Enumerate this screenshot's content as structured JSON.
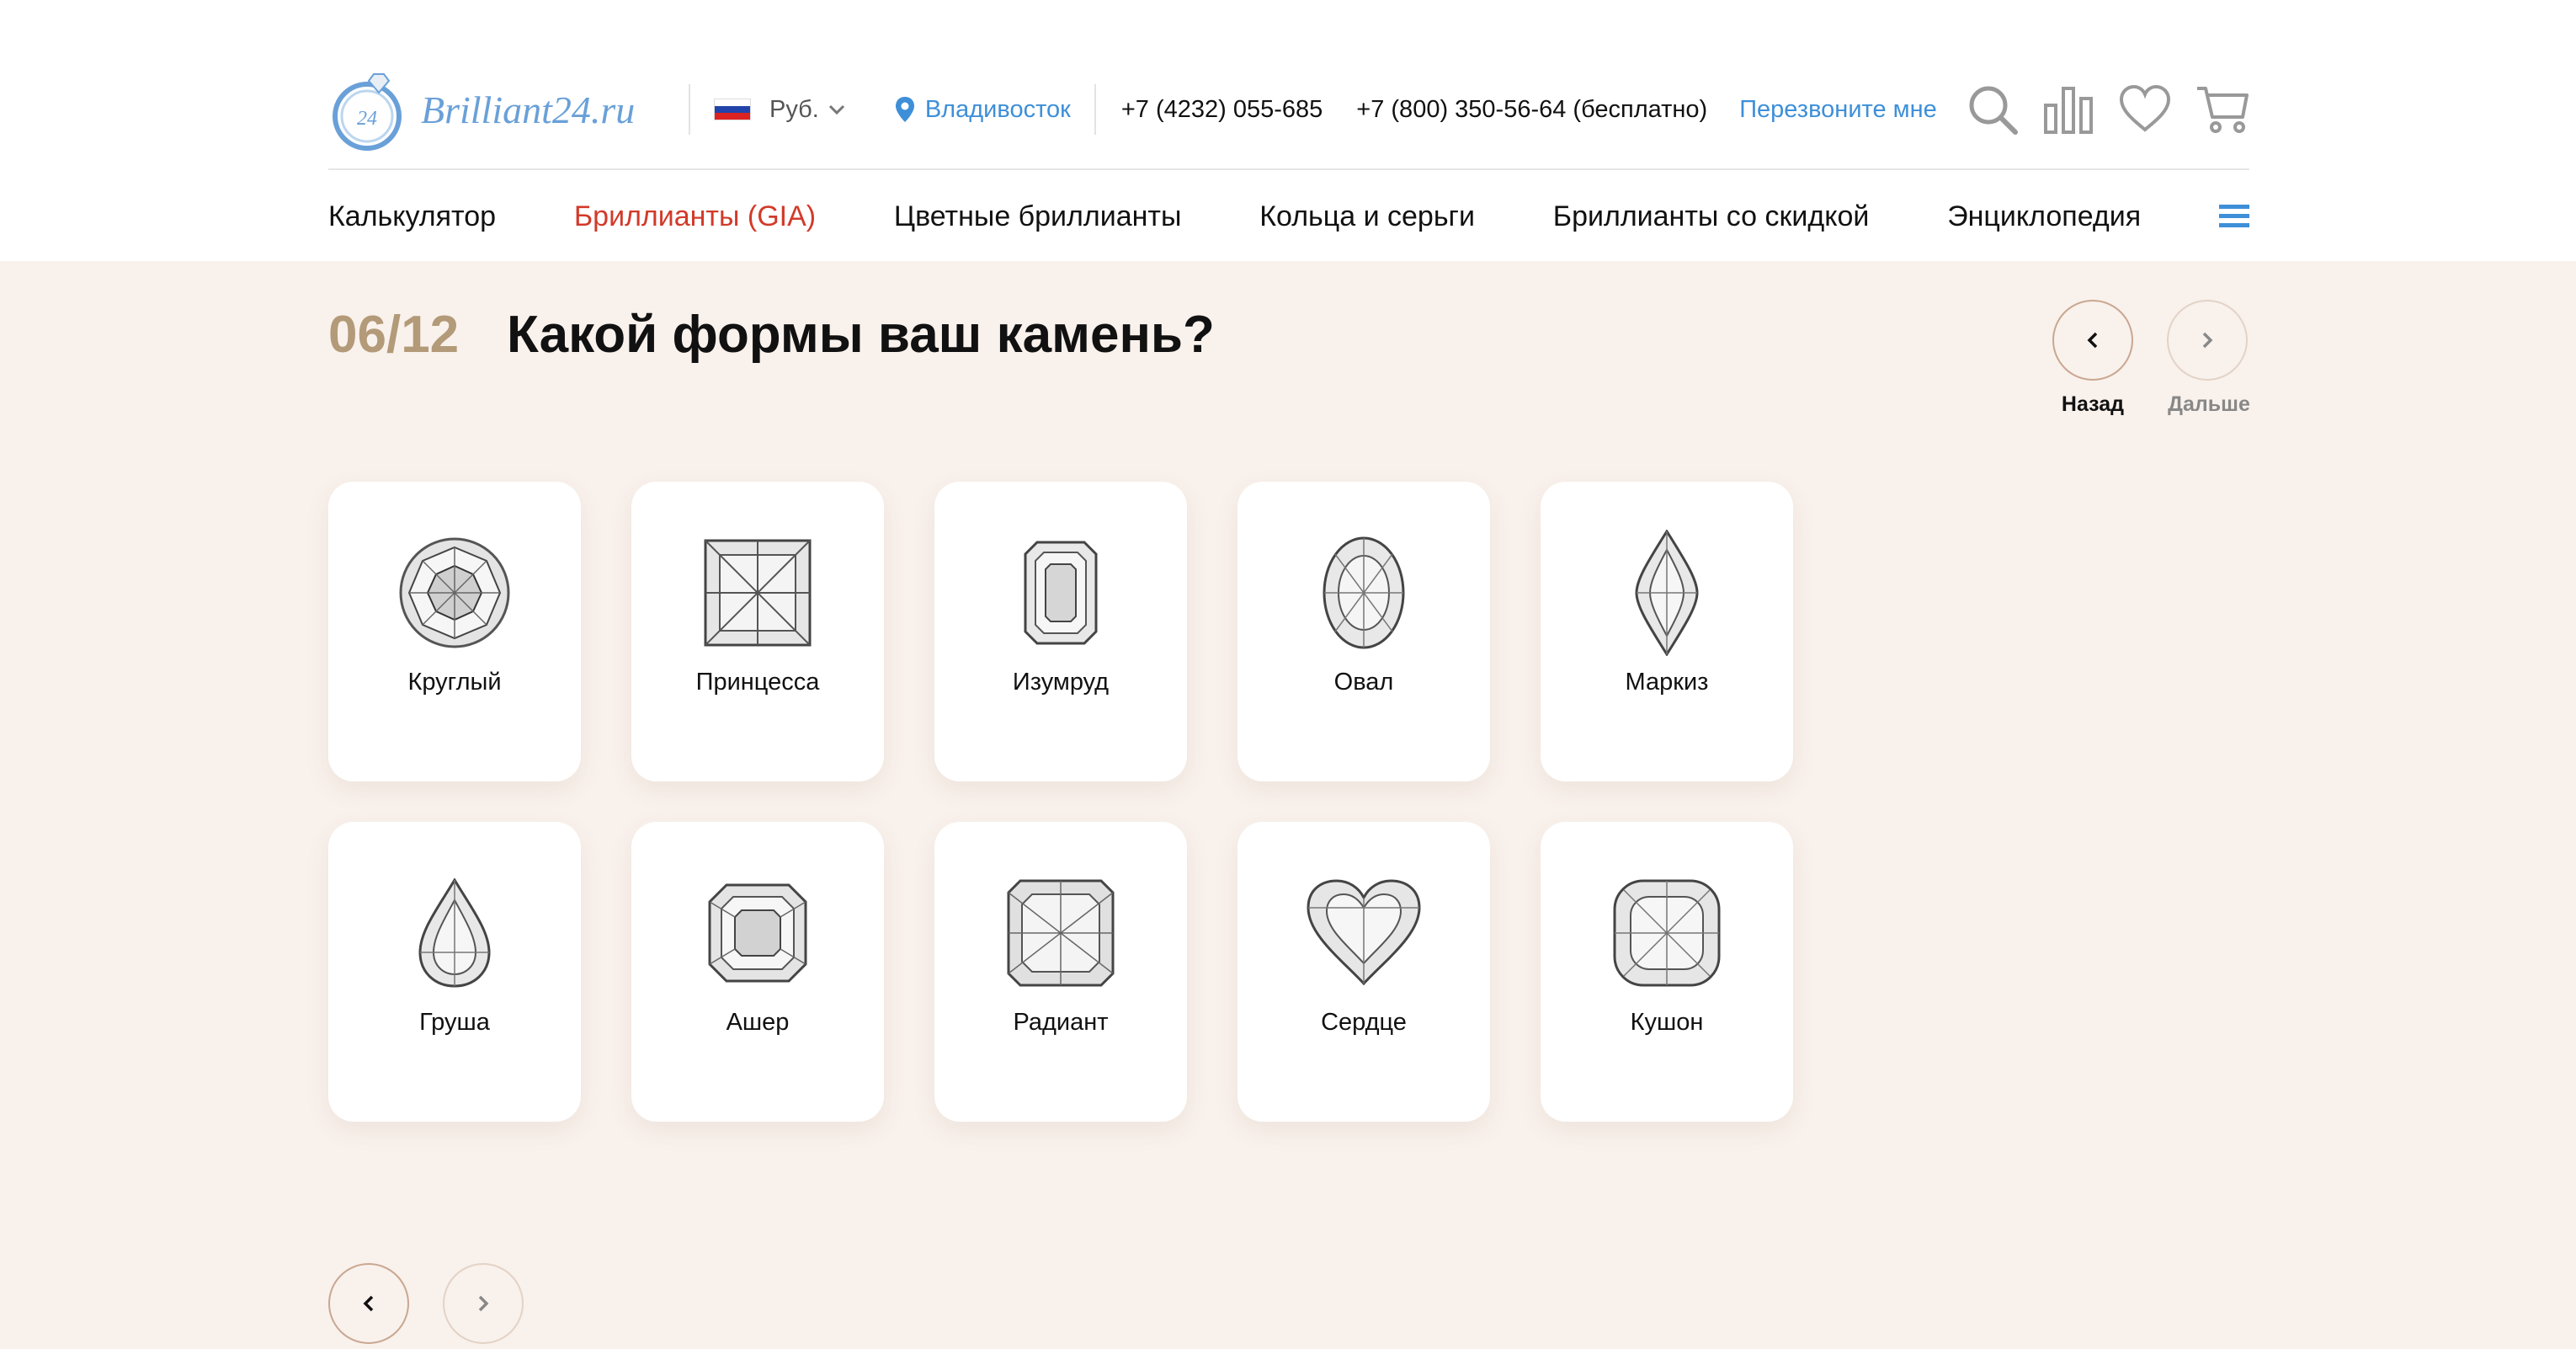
{
  "header": {
    "logo_text": "Brilliant24.ru",
    "logo_badge": "24",
    "currency": "Руб.",
    "city": "Владивосток",
    "phone_local": "+7 (4232) 055-685",
    "phone_free": "+7 (800) 350-56-64 (бесплатно)",
    "callback": "Перезвоните мне",
    "icons": [
      "search-icon",
      "compare-icon",
      "heart-icon",
      "cart-icon"
    ]
  },
  "nav": {
    "items": [
      {
        "label": "Калькулятор",
        "active": false
      },
      {
        "label": "Бриллианты (GIA)",
        "active": true
      },
      {
        "label": "Цветные бриллианты",
        "active": false
      },
      {
        "label": "Кольца и серьги",
        "active": false
      },
      {
        "label": "Бриллианты со скидкой",
        "active": false
      },
      {
        "label": "Энциклопедия",
        "active": false
      }
    ],
    "menu_icon": "hamburger-icon"
  },
  "quiz": {
    "step": "06/12",
    "question": "Какой формы ваш камень?",
    "back_label": "Назад",
    "next_label": "Дальше",
    "shapes": [
      {
        "label": "Круглый",
        "icon": "round-diamond-icon"
      },
      {
        "label": "Принцесса",
        "icon": "princess-diamond-icon"
      },
      {
        "label": "Изумруд",
        "icon": "emerald-diamond-icon"
      },
      {
        "label": "Овал",
        "icon": "oval-diamond-icon"
      },
      {
        "label": "Маркиз",
        "icon": "marquise-diamond-icon"
      },
      {
        "label": "Груша",
        "icon": "pear-diamond-icon"
      },
      {
        "label": "Ашер",
        "icon": "asscher-diamond-icon"
      },
      {
        "label": "Радиант",
        "icon": "radiant-diamond-icon"
      },
      {
        "label": "Сердце",
        "icon": "heart-diamond-icon"
      },
      {
        "label": "Кушон",
        "icon": "cushion-diamond-icon"
      }
    ]
  },
  "colors": {
    "accent_blue": "#3e8fd8",
    "active_red": "#d23a2a",
    "step_gold": "#b39a78",
    "page_bg": "#f9f1ec"
  }
}
